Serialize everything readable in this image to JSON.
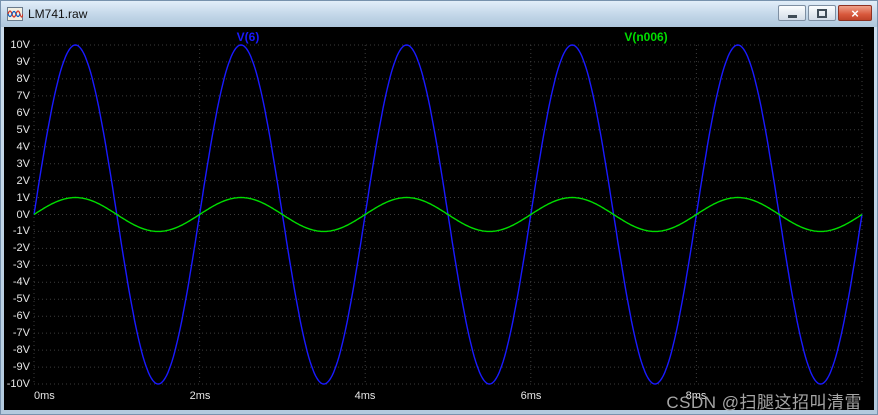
{
  "window": {
    "title": "LM741.raw",
    "controls": {
      "minimize_label": "Minimize",
      "maximize_label": "Maximize",
      "close_label": "Close",
      "close_glyph": "×"
    }
  },
  "chart_data": {
    "type": "line",
    "title": "",
    "xlabel": "",
    "ylabel": "",
    "x_unit": "ms",
    "x_range": [
      0,
      10
    ],
    "x_major_step": 2,
    "x_tick_values": [
      0,
      2,
      4,
      6,
      8
    ],
    "x_tick_labels": [
      "0ms",
      "2ms",
      "4ms",
      "6ms",
      "8ms"
    ],
    "y_unit": "V",
    "y_range": [
      -10,
      10
    ],
    "y_tick_step": 1,
    "y_tick_labels": [
      "10V",
      "9V",
      "8V",
      "7V",
      "6V",
      "5V",
      "4V",
      "3V",
      "2V",
      "1V",
      "0V",
      "-1V",
      "-2V",
      "-3V",
      "-4V",
      "-5V",
      "-6V",
      "-7V",
      "-8V",
      "-9V",
      "-10V"
    ],
    "grid": true,
    "legend_position": "top",
    "background_color": "#000000",
    "grid_color": "#3d3d3d",
    "tick_label_color": "#e6e6e6",
    "series": [
      {
        "name": "V(6)",
        "color": "#1a1aff",
        "waveform": "sine",
        "amplitude_V": 10,
        "offset_V": 0,
        "period_ms": 2,
        "phase_deg": 0
      },
      {
        "name": "V(n006)",
        "color": "#00dd00",
        "waveform": "sine",
        "amplitude_V": 1,
        "offset_V": 0,
        "period_ms": 2,
        "phase_deg": 0
      }
    ]
  },
  "watermark": {
    "text": "CSDN @扫腿这招叫清雷"
  }
}
